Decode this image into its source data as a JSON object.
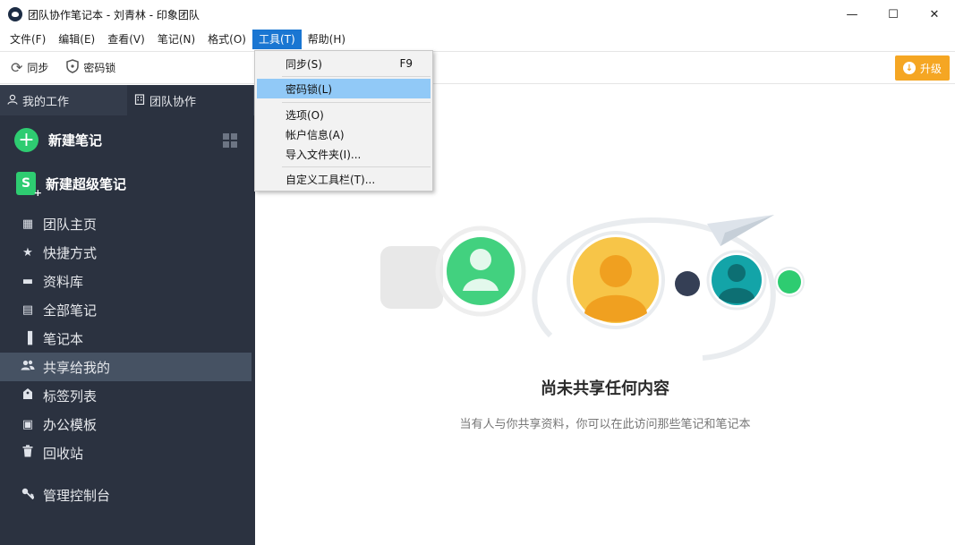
{
  "window": {
    "title": "团队协作笔记本 - 刘青林 - 印象团队",
    "minimize": "—",
    "maximize": "☐",
    "close": "✕"
  },
  "menubar": [
    {
      "label": "文件(F)"
    },
    {
      "label": "编辑(E)"
    },
    {
      "label": "查看(V)"
    },
    {
      "label": "笔记(N)"
    },
    {
      "label": "格式(O)"
    },
    {
      "label": "工具(T)",
      "active": true
    },
    {
      "label": "帮助(H)"
    }
  ],
  "toolbar": {
    "sync_label": "同步",
    "sync_icon": "sync-icon",
    "lock_label": "密码锁",
    "lock_icon": "shield-icon",
    "upgrade_label": "升级",
    "upgrade_color": "#f5a623"
  },
  "tools_menu": {
    "items": [
      {
        "label": "同步(S)",
        "shortcut": "F9"
      },
      {
        "label": "密码锁(L)",
        "highlighted": true
      },
      {
        "label": "选项(O)"
      },
      {
        "label": "帐户信息(A)"
      },
      {
        "label": "导入文件夹(I)..."
      },
      {
        "label": "自定义工具栏(T)..."
      }
    ]
  },
  "sidebar": {
    "tabs": [
      {
        "label": "我的工作",
        "icon": "user-icon"
      },
      {
        "label": "团队协作",
        "icon": "building-icon"
      }
    ],
    "new_note": "新建笔记",
    "new_super_note": "新建超级笔记",
    "items": [
      {
        "label": "团队主页",
        "icon": "building-icon"
      },
      {
        "label": "快捷方式",
        "icon": "star-icon"
      },
      {
        "label": "资料库",
        "icon": "library-icon"
      },
      {
        "label": "全部笔记",
        "icon": "note-icon"
      },
      {
        "label": "笔记本",
        "icon": "notebook-icon"
      },
      {
        "label": "共享给我的",
        "icon": "people-icon",
        "selected": true
      },
      {
        "label": "标签列表",
        "icon": "tag-icon"
      },
      {
        "label": "办公模板",
        "icon": "template-icon"
      },
      {
        "label": "回收站",
        "icon": "trash-icon"
      }
    ],
    "admin": "管理控制台",
    "bg_color": "#2b3240",
    "accent_color": "#2ecc71"
  },
  "main": {
    "empty_title": "尚未共享任何内容",
    "empty_desc": "当有人与你共享资料，你可以在此访问那些笔记和笔记本"
  }
}
